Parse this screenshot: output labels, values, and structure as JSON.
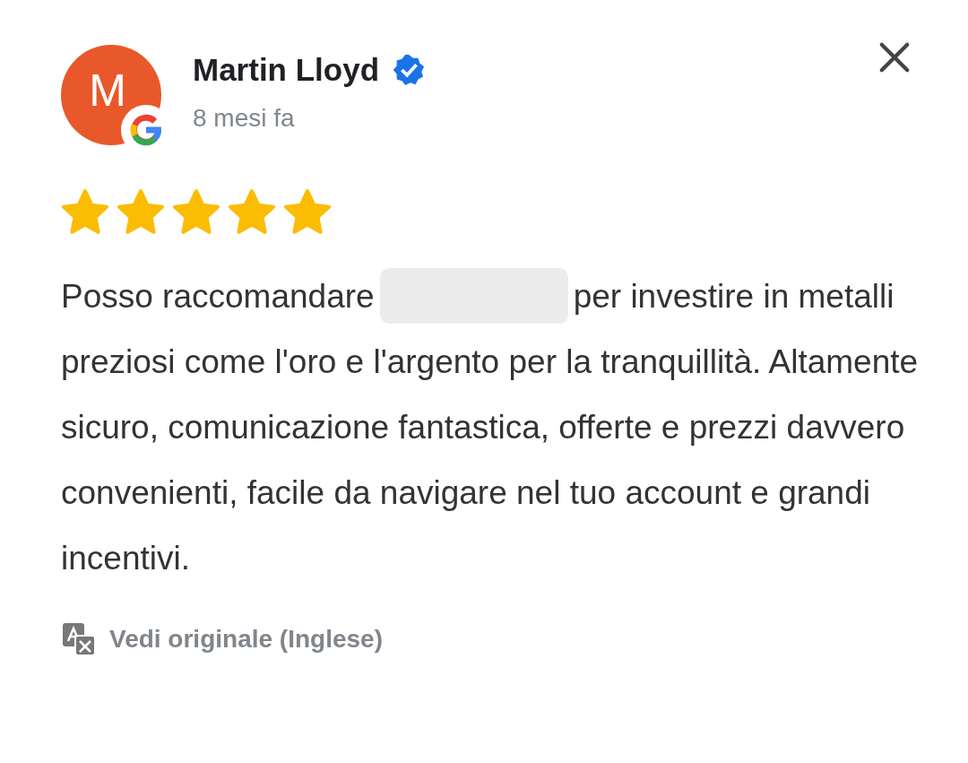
{
  "review": {
    "author": "Martin Lloyd",
    "avatar_initial": "M",
    "verified": true,
    "time": "8 mesi fa",
    "stars": 5,
    "text_before": "Posso raccomandare",
    "redacted": true,
    "text_after": "per investire in metalli preziosi come l'oro e l'argento per la tranquillità. Altamente sicuro, comunicazione fantastica, offerte e prezzi davvero convenienti, facile da navigare nel tuo account e grandi incentivi."
  },
  "translate_link": "Vedi originale (Inglese)"
}
